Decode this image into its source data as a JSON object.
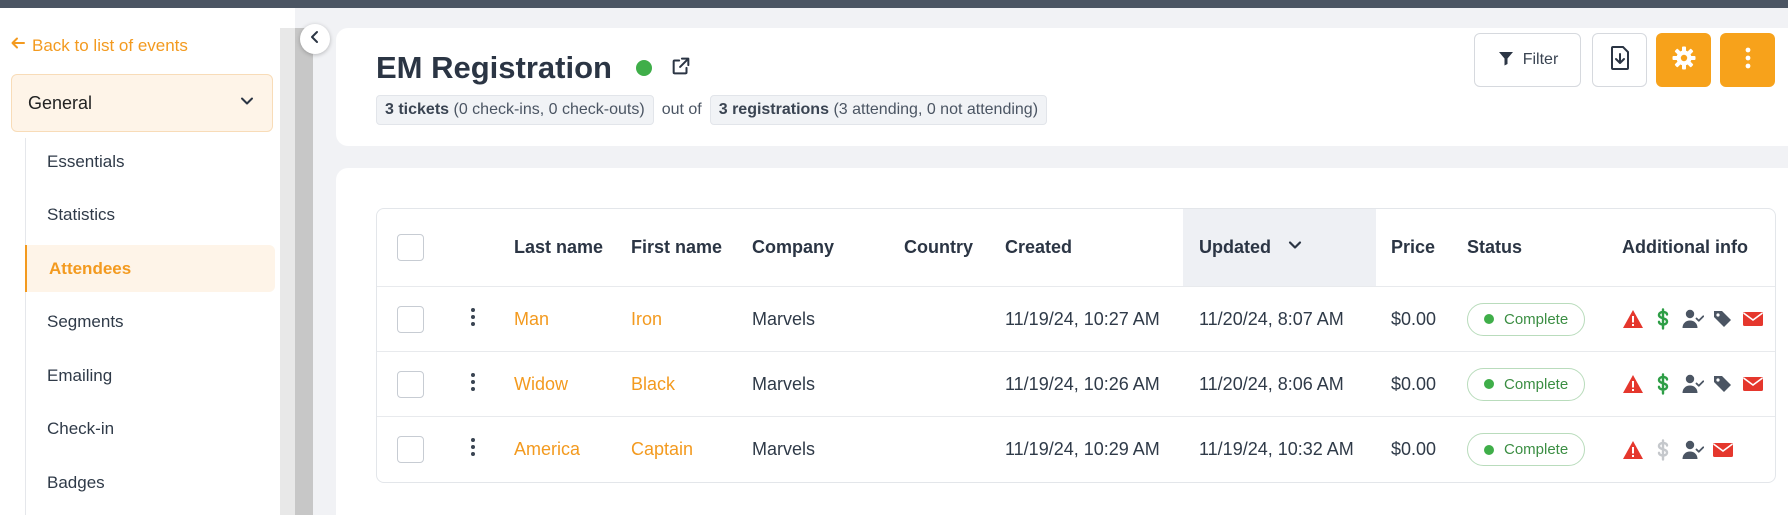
{
  "sidebar": {
    "back_label": "Back to list of events",
    "section_label": "General",
    "items": [
      {
        "label": "Essentials",
        "active": false
      },
      {
        "label": "Statistics",
        "active": false
      },
      {
        "label": "Attendees",
        "active": true
      },
      {
        "label": "Segments",
        "active": false
      },
      {
        "label": "Emailing",
        "active": false
      },
      {
        "label": "Check-in",
        "active": false
      },
      {
        "label": "Badges",
        "active": false
      }
    ]
  },
  "header": {
    "title": "EM Registration",
    "tickets_count": "3 tickets",
    "tickets_detail": "(0 check-ins, 0 check-outs)",
    "out_of": "out of",
    "registrations_count": "3 registrations",
    "registrations_detail": "(3 attending, 0 not attending)",
    "filter_label": "Filter"
  },
  "table": {
    "columns": {
      "last_name": "Last name",
      "first_name": "First name",
      "company": "Company",
      "country": "Country",
      "created": "Created",
      "updated": "Updated",
      "price": "Price",
      "status": "Status",
      "additional_info": "Additional info"
    },
    "rows": [
      {
        "last_name": "Man",
        "first_name": "Iron",
        "company": "Marvels",
        "country": "",
        "created": "11/19/24, 10:27 AM",
        "updated": "11/20/24, 8:07 AM",
        "price": "$0.00",
        "status": "Complete"
      },
      {
        "last_name": "Widow",
        "first_name": "Black",
        "company": "Marvels",
        "country": "",
        "created": "11/19/24, 10:26 AM",
        "updated": "11/20/24, 8:06 AM",
        "price": "$0.00",
        "status": "Complete"
      },
      {
        "last_name": "America",
        "first_name": "Captain",
        "company": "Marvels",
        "country": "",
        "created": "11/19/24, 10:29 AM",
        "updated": "11/19/24, 10:32 AM",
        "price": "$0.00",
        "status": "Complete"
      }
    ]
  },
  "icons": {
    "back": "arrow-left-icon",
    "section": "chevron-down-icon",
    "collapse": "chevron-left-icon",
    "external": "external-link-icon",
    "filter": "filter-icon",
    "export": "file-download-icon",
    "settings": "gear-icon",
    "more": "kebab-icon",
    "sort": "chevron-down-icon",
    "info": [
      "warning-icon",
      "dollar-icon",
      "user-check-icon",
      "tags-icon",
      "envelope-icon"
    ]
  },
  "colors": {
    "accent": "#f39a1f",
    "button_accent": "#f7a21b",
    "status_green": "#3fae49",
    "warning_red": "#e5372d",
    "dollar_green": "#2e9e46",
    "dollar_muted": "#c5c8cc",
    "user_icon": "#4b5563",
    "tag_icon": "#4b5563"
  }
}
